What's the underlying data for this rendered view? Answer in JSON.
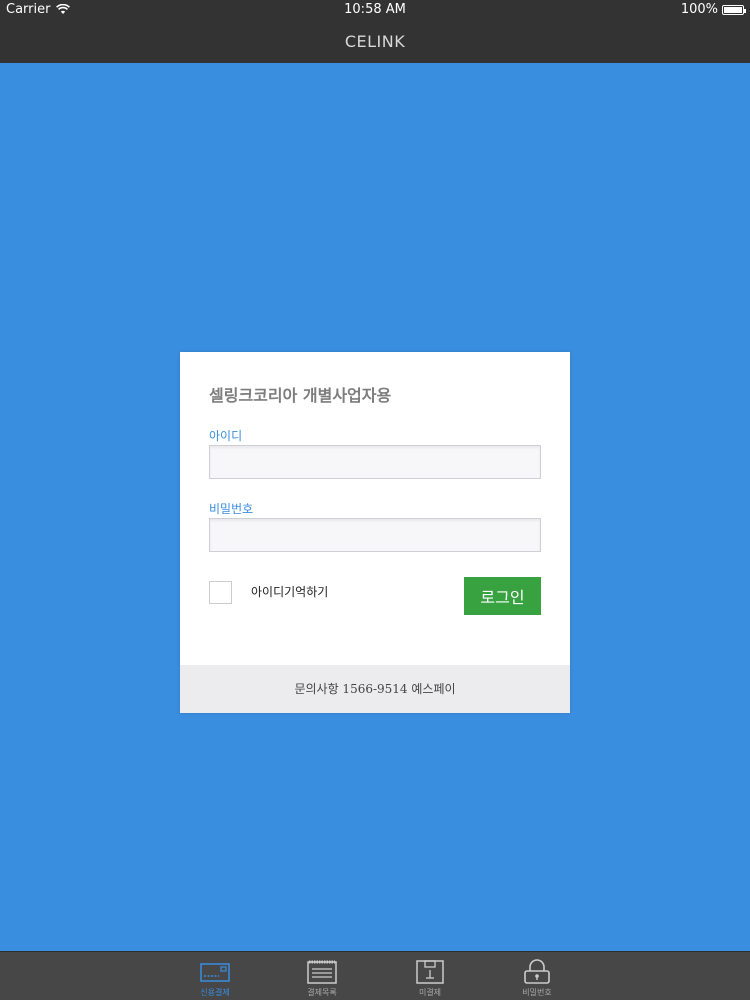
{
  "status_bar": {
    "carrier": "Carrier",
    "time": "10:58 AM",
    "battery": "100%"
  },
  "nav": {
    "title": "CELINK"
  },
  "login": {
    "title": "셀링크코리아 개별사업자용",
    "id_label": "아이디",
    "id_value": "",
    "password_label": "비밀번호",
    "password_value": "",
    "remember_label": "아이디기억하기",
    "remember_checked": false,
    "login_button": "로그인",
    "footer": "문의사항 1566-9514 예스페이"
  },
  "tabs": [
    {
      "label": "신용결제",
      "icon": "card-reader-icon",
      "active": true
    },
    {
      "label": "결제목록",
      "icon": "receipt-list-icon",
      "active": false
    },
    {
      "label": "미결제",
      "icon": "pending-payment-icon",
      "active": false
    },
    {
      "label": "비밀번호",
      "icon": "lock-icon",
      "active": false
    }
  ],
  "colors": {
    "background": "#3a8ee0",
    "bars": "#333333",
    "login_button": "#37a23f",
    "accent": "#3a8ee0"
  }
}
